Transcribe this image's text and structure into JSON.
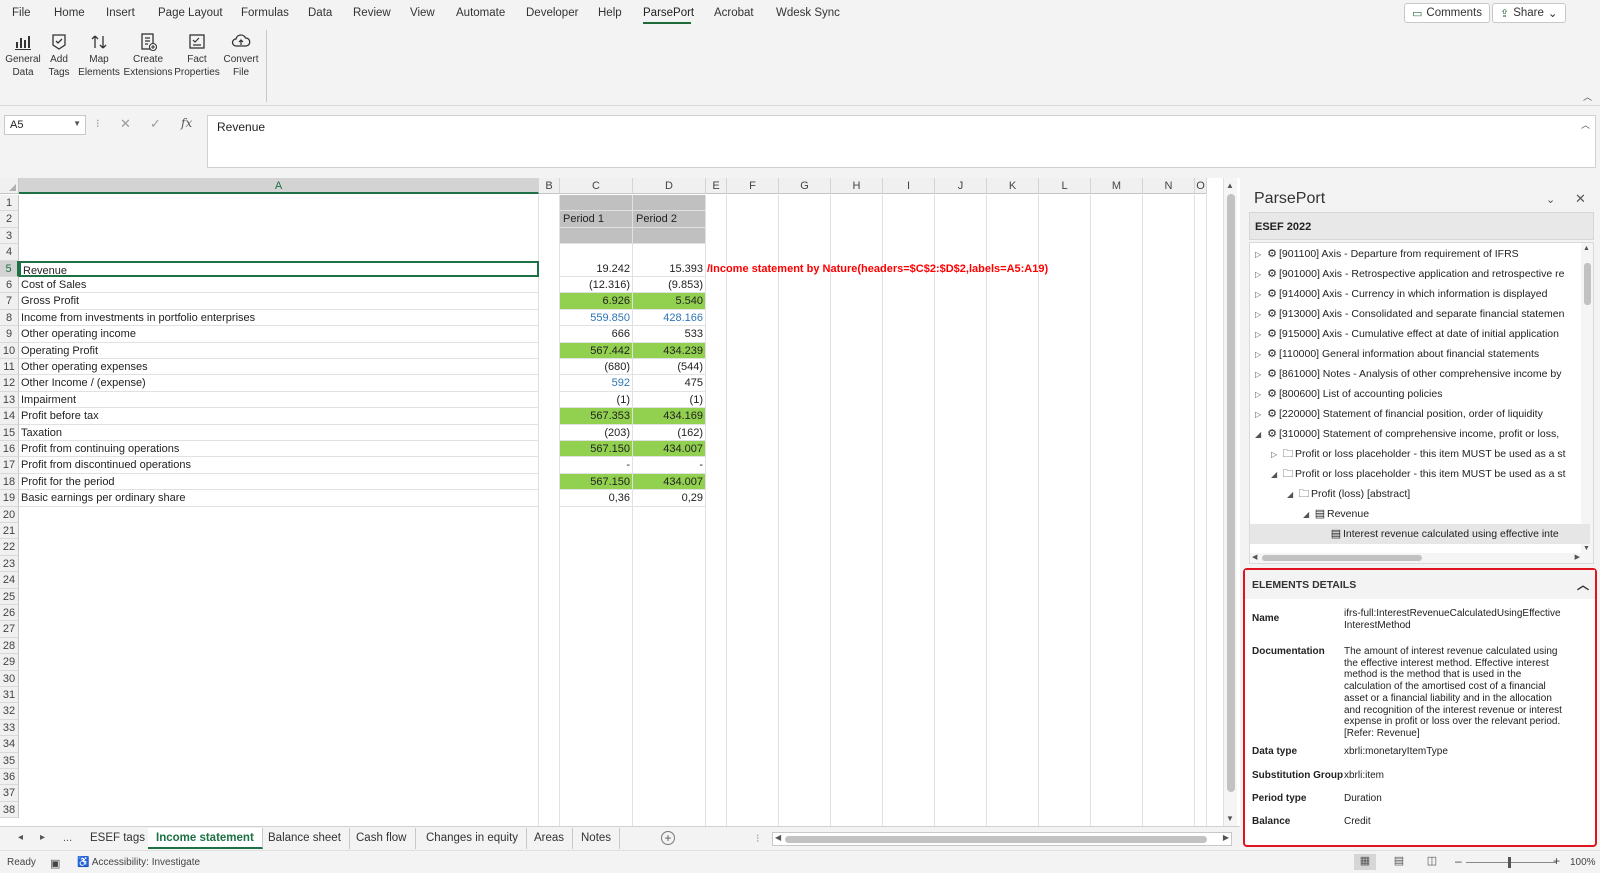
{
  "menu": {
    "items": [
      "File",
      "Home",
      "Insert",
      "Page Layout",
      "Formulas",
      "Data",
      "Review",
      "View",
      "Automate",
      "Developer",
      "Help",
      "ParsePort",
      "Acrobat",
      "Wdesk Sync"
    ],
    "active": "ParsePort",
    "comments_label": "Comments",
    "share_label": "Share"
  },
  "ribbon": {
    "buttons": [
      {
        "line1": "General",
        "line2": "Data"
      },
      {
        "line1": "Add",
        "line2": "Tags"
      },
      {
        "line1": "Map",
        "line2": "Elements"
      },
      {
        "line1": "Create",
        "line2": "Extensions"
      },
      {
        "line1": "Fact",
        "line2": "Properties"
      },
      {
        "line1": "Convert",
        "line2": "File"
      }
    ]
  },
  "formula_bar": {
    "name_box": "A5",
    "formula": "Revenue"
  },
  "sheet": {
    "columns": [
      "A",
      "B",
      "C",
      "D",
      "E",
      "F",
      "G",
      "H",
      "I",
      "J",
      "K",
      "L",
      "M",
      "N",
      "O"
    ],
    "selected_column": "A",
    "selected_row": "5",
    "row_numbers": [
      "1",
      "2",
      "3",
      "4",
      "5",
      "6",
      "7",
      "8",
      "9",
      "10",
      "11",
      "12",
      "13",
      "14",
      "15",
      "16",
      "17",
      "18",
      "19",
      "20",
      "21",
      "22",
      "23",
      "24",
      "25",
      "26",
      "27",
      "28",
      "29",
      "30",
      "31",
      "32",
      "33",
      "34",
      "35",
      "36",
      "37",
      "38"
    ],
    "header_c": "Period 1",
    "header_d": "Period 2",
    "rows": [
      {
        "label": "Revenue",
        "c": "19.242",
        "d": "15.393"
      },
      {
        "label": "Cost of Sales",
        "c": "(12.316)",
        "d": "(9.853)"
      },
      {
        "label": "Gross Profit",
        "c": "6.926",
        "d": "5.540"
      },
      {
        "label": "Income from investments in portfolio enterprises",
        "c": "559.850",
        "d": "428.166"
      },
      {
        "label": "Other operating income",
        "c": "666",
        "d": "533"
      },
      {
        "label": "Operating Profit",
        "c": "567.442",
        "d": "434.239"
      },
      {
        "label": "Other operating expenses",
        "c": "(680)",
        "d": "(544)"
      },
      {
        "label": "Other Income / (expense)",
        "c": "592",
        "d": "475"
      },
      {
        "label": "Impairment",
        "c": "(1)",
        "d": "(1)"
      },
      {
        "label": "Profit before tax",
        "c": "567.353",
        "d": "434.169"
      },
      {
        "label": "Taxation",
        "c": "(203)",
        "d": "(162)"
      },
      {
        "label": "Profit from continuing operations",
        "c": "567.150",
        "d": "434.007"
      },
      {
        "label": "Profit from discontinued operations",
        "c": "-",
        "d": "-"
      },
      {
        "label": "Profit for the period",
        "c": "567.150",
        "d": "434.007"
      },
      {
        "label": "Basic earnings per ordinary share",
        "c": "0,36",
        "d": "0,29"
      }
    ],
    "green_rows": [
      2,
      5,
      9,
      11,
      13
    ],
    "blue_c_rows": [
      3,
      7
    ],
    "blue_d_rows": [
      3
    ],
    "annotation": "/Income statement by Nature(headers=$C$2:$D$2,labels=A5:A19)"
  },
  "tabs": {
    "items": [
      "ESEF tags",
      "Income statement",
      "Balance sheet",
      "Cash flow",
      "Changes in equity",
      "Areas",
      "Notes"
    ],
    "active": "Income statement",
    "ellipsis": "..."
  },
  "status": {
    "ready": "Ready",
    "accessibility": "Accessibility: Investigate",
    "zoom": "100%"
  },
  "pane": {
    "title": "ParsePort",
    "taxonomy": "ESEF 2022",
    "tree": [
      {
        "level": 0,
        "twisty": "▷",
        "icon": "gear",
        "text": "[901100] Axis - Departure from requirement of IFRS"
      },
      {
        "level": 0,
        "twisty": "▷",
        "icon": "gear",
        "text": "[901000] Axis - Retrospective application and retrospective re"
      },
      {
        "level": 0,
        "twisty": "▷",
        "icon": "gear",
        "text": "[914000] Axis - Currency in which information is displayed"
      },
      {
        "level": 0,
        "twisty": "▷",
        "icon": "gear",
        "text": "[913000] Axis - Consolidated and separate financial statemen"
      },
      {
        "level": 0,
        "twisty": "▷",
        "icon": "gear",
        "text": "[915000] Axis - Cumulative effect at date of initial application"
      },
      {
        "level": 0,
        "twisty": "▷",
        "icon": "gear",
        "text": "[110000] General information about financial statements"
      },
      {
        "level": 0,
        "twisty": "▷",
        "icon": "gear",
        "text": "[861000] Notes - Analysis of other comprehensive income by"
      },
      {
        "level": 0,
        "twisty": "▷",
        "icon": "gear",
        "text": "[800600] List of accounting policies"
      },
      {
        "level": 0,
        "twisty": "▷",
        "icon": "gear",
        "text": "[220000] Statement of financial position, order of liquidity"
      },
      {
        "level": 0,
        "twisty": "◢",
        "icon": "gear",
        "text": "[310000] Statement of comprehensive income, profit or loss, "
      },
      {
        "level": 1,
        "twisty": "▷",
        "icon": "folder",
        "text": "Profit or loss placeholder - this item MUST be used as a st"
      },
      {
        "level": 1,
        "twisty": "◢",
        "icon": "folder",
        "text": "Profit or loss placeholder - this item MUST be used as a st"
      },
      {
        "level": 2,
        "twisty": "◢",
        "icon": "folder",
        "text": "Profit (loss) [abstract]"
      },
      {
        "level": 3,
        "twisty": "◢",
        "icon": "doc",
        "text": "Revenue"
      },
      {
        "level": 4,
        "twisty": "",
        "icon": "doc",
        "text": "Interest revenue calculated using effective inte"
      }
    ],
    "selected_tree_index": 14,
    "details": {
      "heading": "ELEMENTS DETAILS",
      "name_key": "Name",
      "name_val": "ifrs-full:InterestRevenueCalculatedUsingEffectiveInterestMethod",
      "doc_key": "Documentation",
      "doc_val": "The amount of interest revenue calculated using the effective interest method. Effective interest method is the method that is used in the calculation of the amortised cost of a financial asset or a financial liability and in the allocation and recognition of the interest revenue or interest expense in profit or loss over the relevant period. [Refer: Revenue]",
      "dtype_key": "Data type",
      "dtype_val": "xbrli:monetaryItemType",
      "subst_key": "Substitution Group",
      "subst_val": "xbrli:item",
      "period_key": "Period type",
      "period_val": "Duration",
      "balance_key": "Balance",
      "balance_val": "Credit"
    }
  },
  "colors": {
    "excel_green": "#1e7145",
    "highlight_green": "#92d050",
    "header_gray": "#c0c0c0",
    "link_blue": "#2e75b6",
    "annotation_red": "#ff0000",
    "details_border": "#e0141e"
  }
}
